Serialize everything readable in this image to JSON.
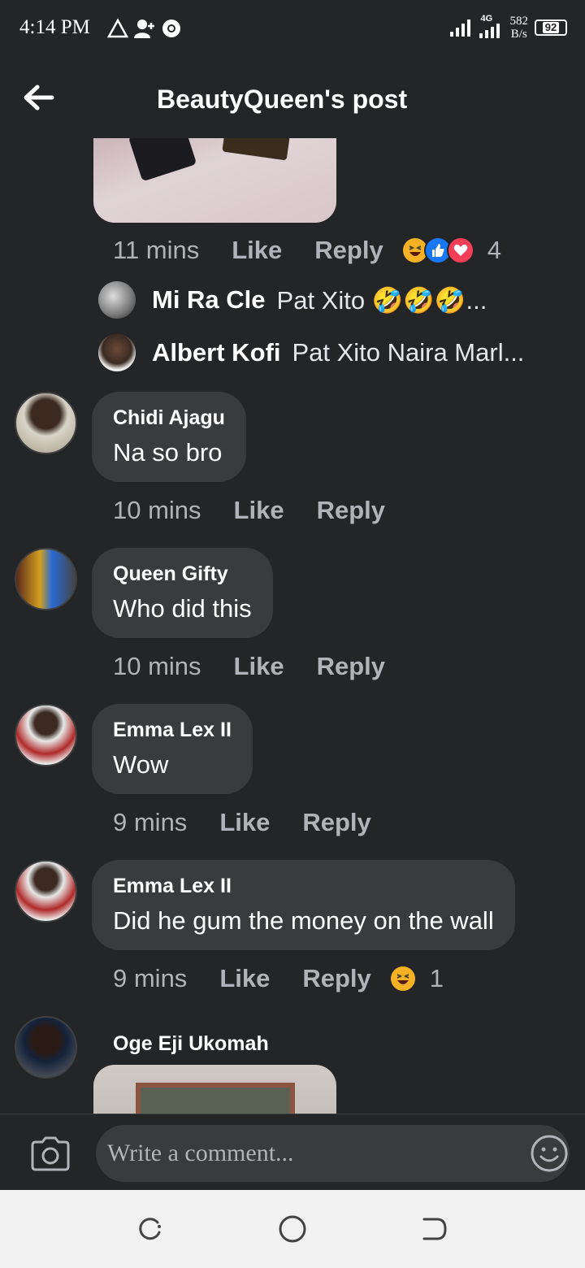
{
  "status_bar": {
    "time": "4:14 PM",
    "network_type": "4G",
    "net_speed_value": "582",
    "net_speed_unit": "B/s",
    "battery": "92"
  },
  "header": {
    "title": "BeautyQueen's post"
  },
  "colors": {
    "background": "#242526",
    "bubble": "#3a3b3c",
    "meta_text": "#b0b3b8",
    "primary_text": "#ffffff"
  },
  "first_comment_meta": {
    "time": "11 mins",
    "like": "Like",
    "reply": "Reply",
    "reaction_icons": [
      "haha-icon",
      "like-icon",
      "love-icon"
    ],
    "reaction_count": "4"
  },
  "replies": [
    {
      "name": "Mi Ra Cle",
      "text": "Pat Xito 🤣🤣🤣..."
    },
    {
      "name": "Albert Kofi",
      "text": "Pat Xito Naira Marl..."
    }
  ],
  "comments": [
    {
      "name": "Chidi Ajagu",
      "text": "Na so bro",
      "time": "10 mins",
      "like": "Like",
      "reply": "Reply"
    },
    {
      "name": "Queen Gifty",
      "text": "Who did this",
      "time": "10 mins",
      "like": "Like",
      "reply": "Reply"
    },
    {
      "name": "Emma Lex II",
      "text": "Wow",
      "time": "9 mins",
      "like": "Like",
      "reply": "Reply"
    },
    {
      "name": "Emma Lex II",
      "text": "Did he gum the money on the wall",
      "time": "9 mins",
      "like": "Like",
      "reply": "Reply",
      "reaction_icons": [
        "haha-icon"
      ],
      "reaction_count": "1"
    },
    {
      "name": "Oge Eji Ukomah"
    }
  ],
  "composer": {
    "placeholder": "Write a comment..."
  }
}
